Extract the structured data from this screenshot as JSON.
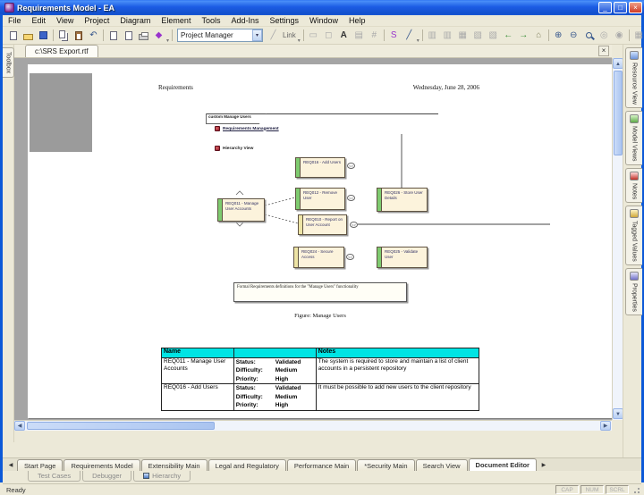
{
  "window": {
    "title": "Requirements Model - EA"
  },
  "menu": {
    "items": [
      "File",
      "Edit",
      "View",
      "Project",
      "Diagram",
      "Element",
      "Tools",
      "Add-Ins",
      "Settings",
      "Window",
      "Help"
    ]
  },
  "toolbar": {
    "combo_value": "Project Manager",
    "link_label": "Link"
  },
  "left_strip": {
    "toolbox_label": "Toolbox"
  },
  "document_tab": {
    "label": "c:\\SRS Export.rtf"
  },
  "page": {
    "header_left": "Requirements",
    "header_right": "Wednesday, June 28, 2006",
    "frame_label": "custom Manage Users",
    "legend": [
      {
        "label": "Requirements Management"
      },
      {
        "label": "Hierarchy View"
      }
    ],
    "boxes": [
      {
        "label": "REQ016 - Add Users"
      },
      {
        "label": "REQ012 - Remove User"
      },
      {
        "label": "REQ011 - Manage User Accounts"
      },
      {
        "label": "REQ010 - Report on User Account"
      },
      {
        "label": "REQ026 - Store User Details"
      },
      {
        "label": "REQ024 - Secure Access"
      },
      {
        "label": "REQ025 - Validate User"
      }
    ],
    "note": "Formal Requirements definitions for the \"Manage Users\" functionality",
    "figure_caption": "Figure: Manage Users",
    "table": {
      "headers": [
        "Name",
        "",
        "Notes"
      ],
      "rows": [
        {
          "name": "REQ011 - Manage User Accounts",
          "props": [
            {
              "label": "Status:",
              "value": "Validated"
            },
            {
              "label": "Difficulty:",
              "value": "Medium"
            },
            {
              "label": "Priority:",
              "value": "High"
            }
          ],
          "notes": "The system is required to store and maintain a list of client accounts in a persistent repository"
        },
        {
          "name": "REQ016 - Add Users",
          "props": [
            {
              "label": "Status:",
              "value": "Validated"
            },
            {
              "label": "Difficulty:",
              "value": "Medium"
            },
            {
              "label": "Priority:",
              "value": "High"
            }
          ],
          "notes": "It must be possible to add new users to the client repository"
        }
      ]
    }
  },
  "right_strip": {
    "tabs": [
      "Resource View",
      "Model Views",
      "Notes",
      "Tagged Values",
      "Properties"
    ]
  },
  "bottom_tabs": {
    "items": [
      "Start Page",
      "Requirements Model",
      "Extensibility Main",
      "Legal and Regulatory",
      "Performance Main",
      "*Security Main",
      "Search View",
      "Document Editor"
    ],
    "active": "Document Editor"
  },
  "tool_tabs": {
    "items": [
      "Test Cases",
      "Debugger",
      "Hierarchy"
    ]
  },
  "status": {
    "ready": "Ready",
    "indicators": [
      "CAP",
      "NUM",
      "SCRL"
    ]
  },
  "colors": {
    "titlebar": "#1c5ce4",
    "req_green": "#7ECB6F",
    "req_yellow": "#EDE4A5",
    "table_header": "#00E4E4",
    "box_fill": "#FCF3DC"
  }
}
